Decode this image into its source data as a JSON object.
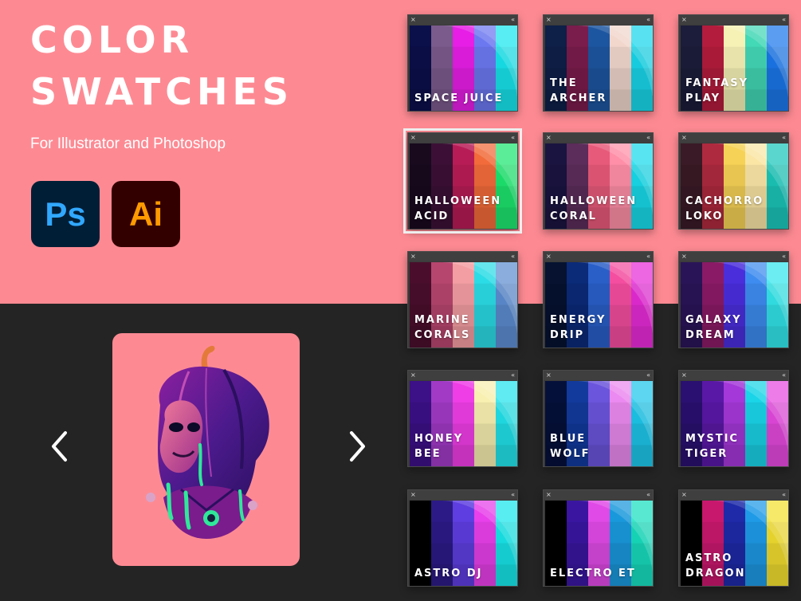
{
  "header": {
    "title_line1": "COLOR",
    "title_line2": "SWATCHES",
    "subtitle": "For Illustrator and Photoshop"
  },
  "apps": [
    {
      "label": "Ps",
      "icon": "photoshop-icon",
      "bg": "#001e36",
      "fg": "#31a8ff"
    },
    {
      "label": "Ai",
      "icon": "illustrator-icon",
      "bg": "#330000",
      "fg": "#ff9a00"
    }
  ],
  "colors": {
    "top_background": "#fd8a93",
    "bottom_background": "#242424",
    "panel_titlebar": "#3f3f3f"
  },
  "carousel": {
    "prev_icon": "chevron-left-icon",
    "next_icon": "chevron-right-icon",
    "image_icon": "pumpkin-skull-illustration-icon"
  },
  "swatches": [
    {
      "name": "SPACE JUICE",
      "colors": [
        "#0b0f4a",
        "#7b5a8c",
        "#e61ee6",
        "#6c78f0",
        "#18e6ee"
      ]
    },
    {
      "name": "THE\nARCHER",
      "colors": [
        "#0e1f48",
        "#7a1c4c",
        "#1d56a0",
        "#f1d7cc",
        "#19d8ec"
      ]
    },
    {
      "name": "FANTASY\nPLAY",
      "colors": [
        "#1c1d3a",
        "#b31c3c",
        "#f6f2b6",
        "#43d8b6",
        "#1c78ec"
      ]
    },
    {
      "name": "HALLOWEEN\nACID",
      "colors": [
        "#190a1e",
        "#3c1036",
        "#b81c56",
        "#f26b3a",
        "#1ee870"
      ]
    },
    {
      "name": "HALLOWEEN\nCORAL",
      "colors": [
        "#1a1440",
        "#5c2d5a",
        "#e85a7a",
        "#ff8fa8",
        "#19dcec"
      ]
    },
    {
      "name": "CACHORRO\nLOKO",
      "colors": [
        "#3a1a26",
        "#ae2a3e",
        "#f6d256",
        "#fbe6a6",
        "#1cc8bc"
      ]
    },
    {
      "name": "MARINE\nCORALS",
      "colors": [
        "#4a0e2c",
        "#b7466e",
        "#f39ea2",
        "#2bdce6",
        "#5e8ed2"
      ]
    },
    {
      "name": "ENERGY\nDRIP",
      "colors": [
        "#061230",
        "#0b2a78",
        "#2a5fc8",
        "#f44ea0",
        "#e82cd8"
      ]
    },
    {
      "name": "GALAXY\nDREAM",
      "colors": [
        "#2a1458",
        "#8a1a66",
        "#4a2edc",
        "#3e8cf0",
        "#33e8ec"
      ]
    },
    {
      "name": "HONEY\nBEE",
      "colors": [
        "#3c1086",
        "#a23ac6",
        "#ef3ee6",
        "#f8f0b0",
        "#22e4ec"
      ]
    },
    {
      "name": "BLUE\nWOLF",
      "colors": [
        "#05103a",
        "#123a9c",
        "#6b55dc",
        "#eb8af0",
        "#1ec8ec"
      ]
    },
    {
      "name": "MYSTIC\nTIGER",
      "colors": [
        "#2a1070",
        "#5a18a6",
        "#a438d8",
        "#1ad4e8",
        "#e64ae0"
      ]
    },
    {
      "name": "ASTRO DJ",
      "colors": [
        "#000000",
        "#2c1a86",
        "#5e3ee0",
        "#e840ea",
        "#18e8ec"
      ]
    },
    {
      "name": "ELECTRO ET",
      "colors": [
        "#000000",
        "#3a16a0",
        "#e04ae6",
        "#1a98dc",
        "#18e0c0"
      ]
    },
    {
      "name": "ASTRO\nDRAGON",
      "colors": [
        "#000000",
        "#c8186e",
        "#1e2aa8",
        "#1e9ae6",
        "#f4e030"
      ]
    }
  ]
}
